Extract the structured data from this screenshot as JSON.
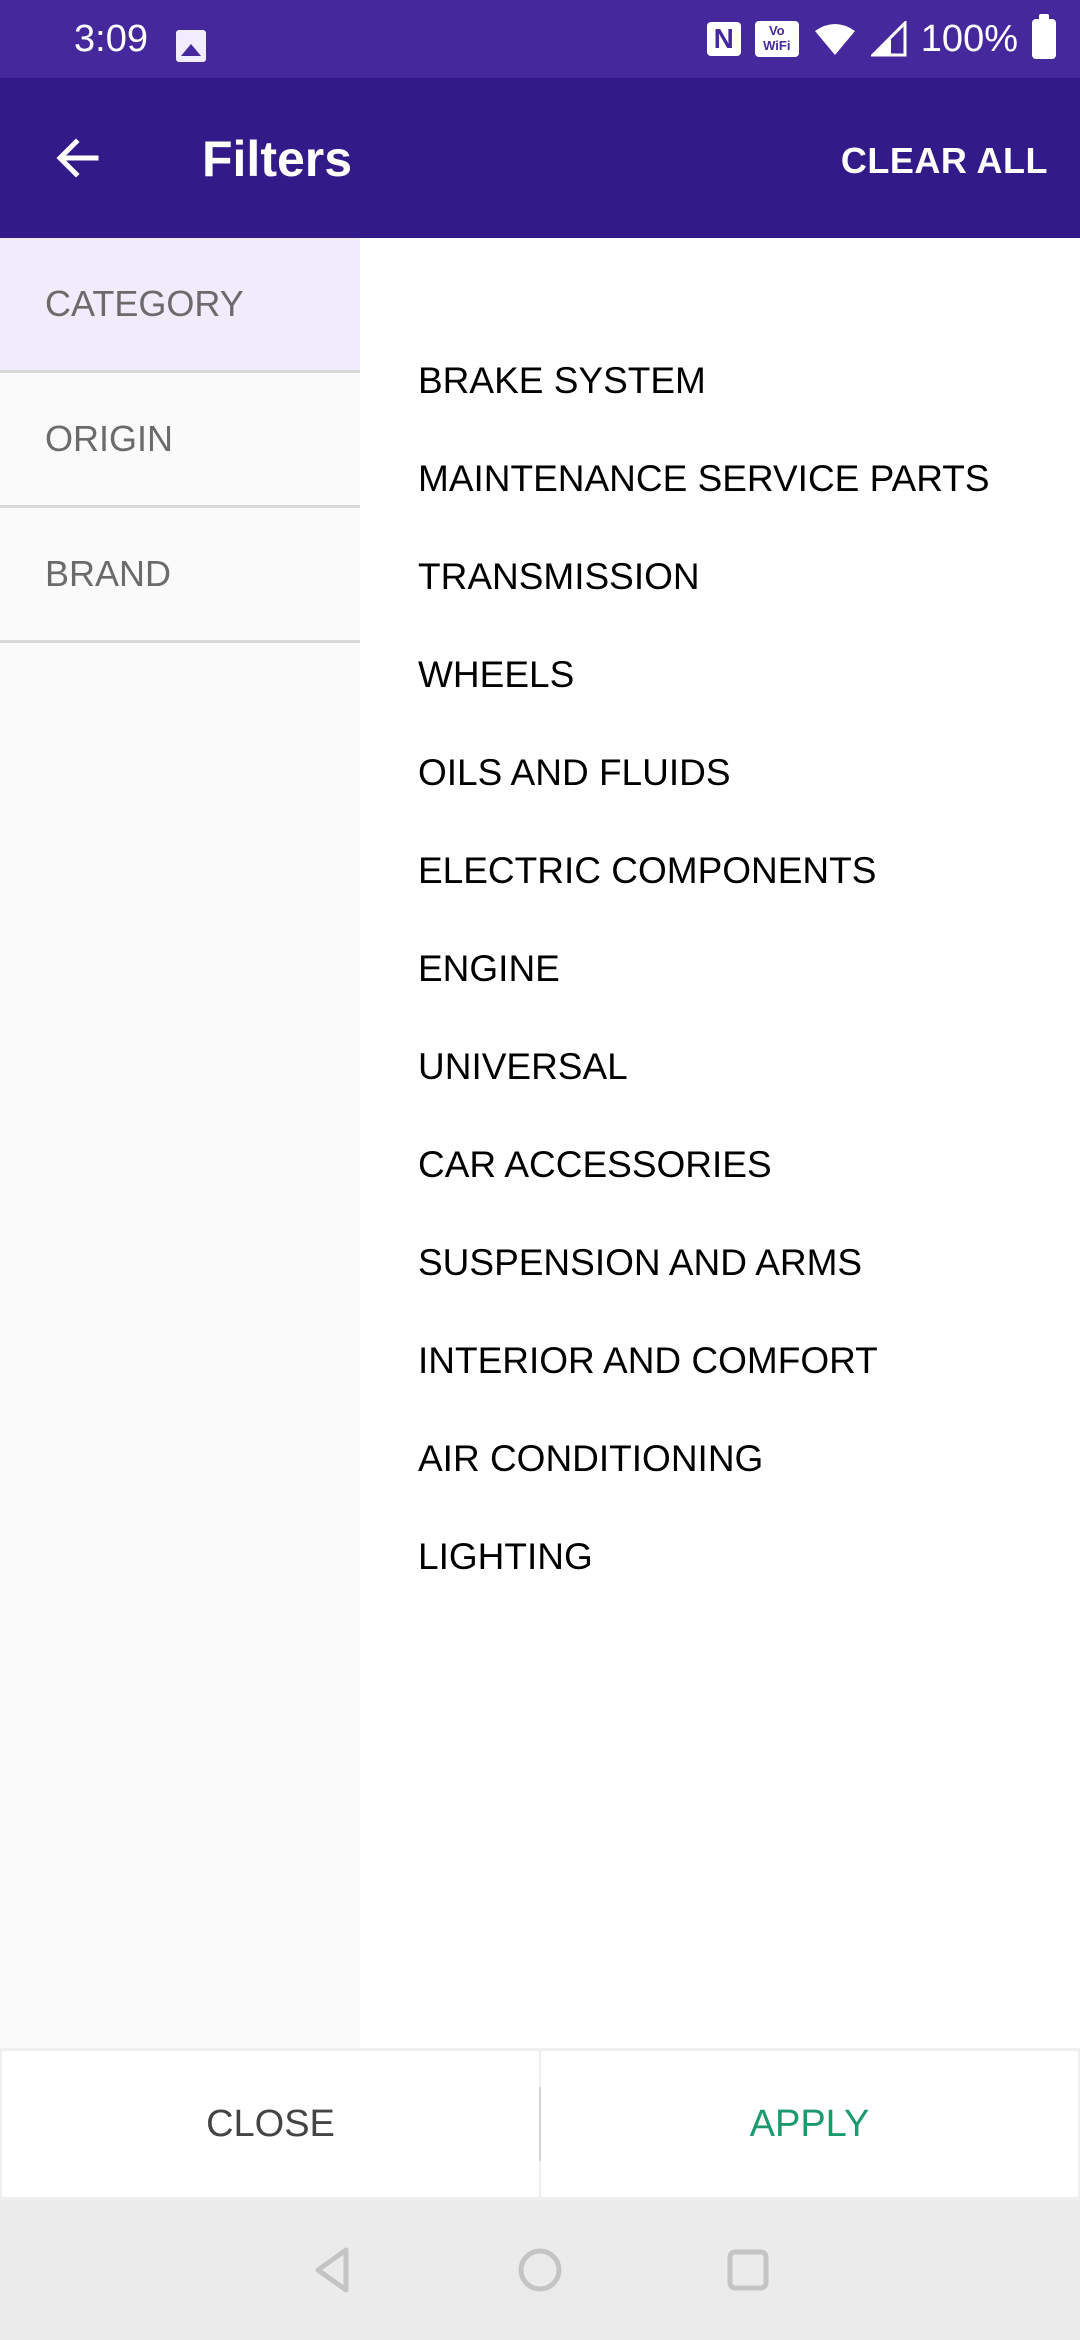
{
  "status_bar": {
    "time": "3:09",
    "battery": "100%",
    "icons": [
      "gallery-icon",
      "nfc-icon",
      "vowifi-icon",
      "wifi-icon",
      "signal-icon",
      "battery-icon"
    ],
    "nfc_label": "N",
    "vowifi_label_line1": "Vo",
    "vowifi_label_line2": "WiFi"
  },
  "app_bar": {
    "title": "Filters",
    "back_icon": "arrow-left-icon",
    "clear_all": "CLEAR ALL"
  },
  "filter_tabs": [
    {
      "label": "CATEGORY",
      "active": true
    },
    {
      "label": "ORIGIN",
      "active": false
    },
    {
      "label": "BRAND",
      "active": false
    }
  ],
  "category_options": [
    "BRAKE SYSTEM",
    "MAINTENANCE SERVICE PARTS",
    "TRANSMISSION",
    "WHEELS",
    "OILS AND FLUIDS",
    "ELECTRIC COMPONENTS",
    "ENGINE",
    "UNIVERSAL",
    "CAR ACCESSORIES",
    "SUSPENSION AND ARMS",
    "INTERIOR AND COMFORT",
    "AIR CONDITIONING",
    "LIGHTING"
  ],
  "bottom_actions": {
    "close": "CLOSE",
    "apply": "APPLY"
  },
  "colors": {
    "status_bar": "#45289c",
    "app_bar": "#321a89",
    "active_tab_bg": "#f1ebfb",
    "apply_text": "#1c9a6c"
  },
  "nav_bar": {
    "icons": [
      "back-triangle-icon",
      "home-circle-icon",
      "recents-square-icon"
    ]
  }
}
